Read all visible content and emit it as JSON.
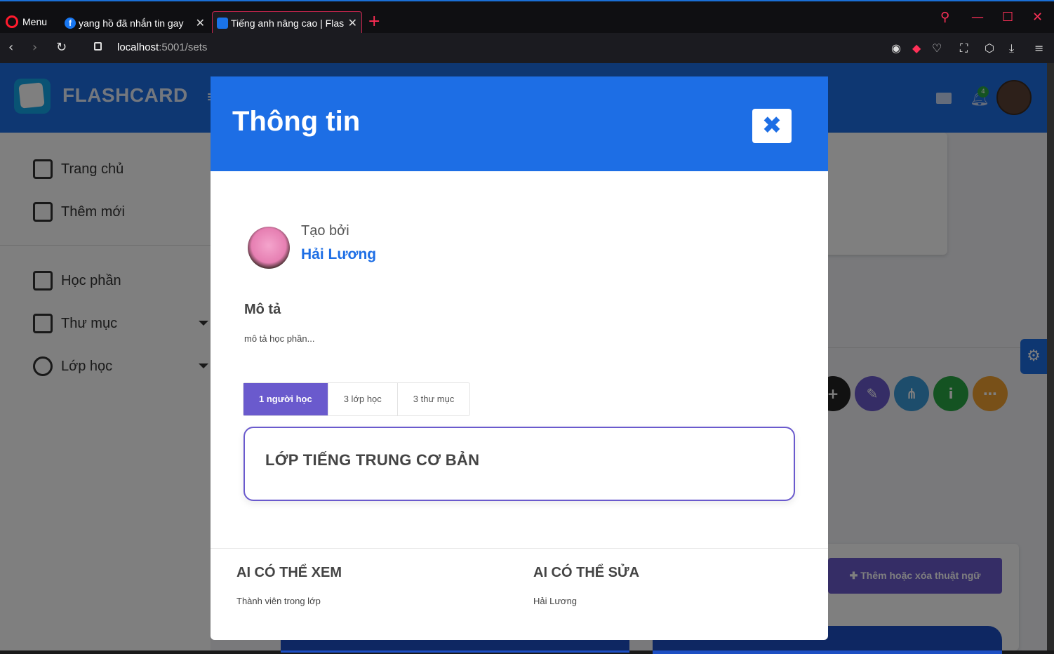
{
  "browser": {
    "menu_label": "Menu",
    "tabs": [
      {
        "title": "yang hồ đã nhắn tin gay",
        "favicon": "facebook-icon"
      },
      {
        "title": "Tiếng anh nâng cao | Flas",
        "favicon": "flashcard-icon"
      }
    ],
    "url_host": "localhost",
    "url_port_path": ":5001/sets"
  },
  "app": {
    "brand": "FLASHCARD",
    "notification_count": "4"
  },
  "sidebar": {
    "items": [
      {
        "label": "Trang chủ",
        "icon": "home-icon"
      },
      {
        "label": "Thêm mới",
        "icon": "edit-icon"
      },
      {
        "label": "Học phần",
        "icon": "copy-icon"
      },
      {
        "label": "Thư mục",
        "icon": "folder-icon"
      },
      {
        "label": "Lớp học",
        "icon": "user-icon"
      }
    ]
  },
  "background": {
    "add_term_label": "Thêm hoặc xóa thuật ngữ"
  },
  "modal": {
    "title": "Thông tin",
    "created_by_label": "Tạo bởi",
    "creator_name": "Hải Lương",
    "description_label": "Mô tả",
    "description_text": "mô tả học phần...",
    "tabs": [
      {
        "label": "1 người học",
        "active": true
      },
      {
        "label": "3 lớp học",
        "active": false
      },
      {
        "label": "3 thư mục",
        "active": false
      }
    ],
    "class_card_title": "LỚP TIẾNG TRUNG CƠ BẢN",
    "who_can_view_label": "AI CÓ THỂ XEM",
    "who_can_view_value": "Thành viên trong lớp",
    "who_can_edit_label": "AI CÓ THỂ SỬA",
    "who_can_edit_value": "Hải Lương"
  },
  "colors": {
    "primary": "#1d6ee5",
    "accent_purple": "#6a5acd"
  }
}
